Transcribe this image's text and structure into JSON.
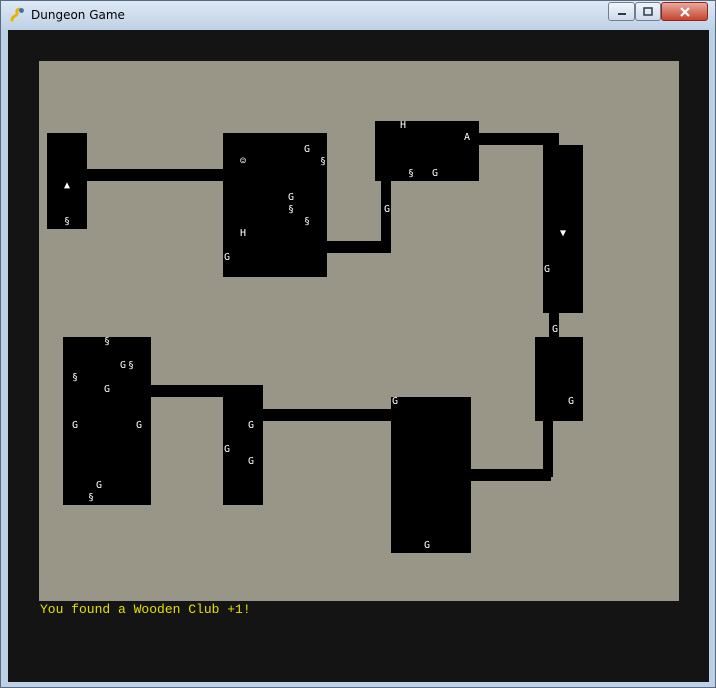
{
  "window": {
    "title": "Dungeon Game",
    "controls": {
      "minimize": "minimize-icon",
      "maximize": "maximize-icon",
      "close": "close-icon"
    }
  },
  "colors": {
    "floor": "#f3efd6",
    "wall": "#000000",
    "background": "#141414",
    "message": "#e3e000",
    "glyph": "#ffffff"
  },
  "map": {
    "glyphs": {
      "player": "☺",
      "goblin": "G",
      "treasure": "§",
      "health": "H",
      "weapon": "A",
      "stairs_up": "▲",
      "stairs_down": "▼"
    }
  },
  "status": {
    "message": "You found a Wooden Club +1!"
  }
}
